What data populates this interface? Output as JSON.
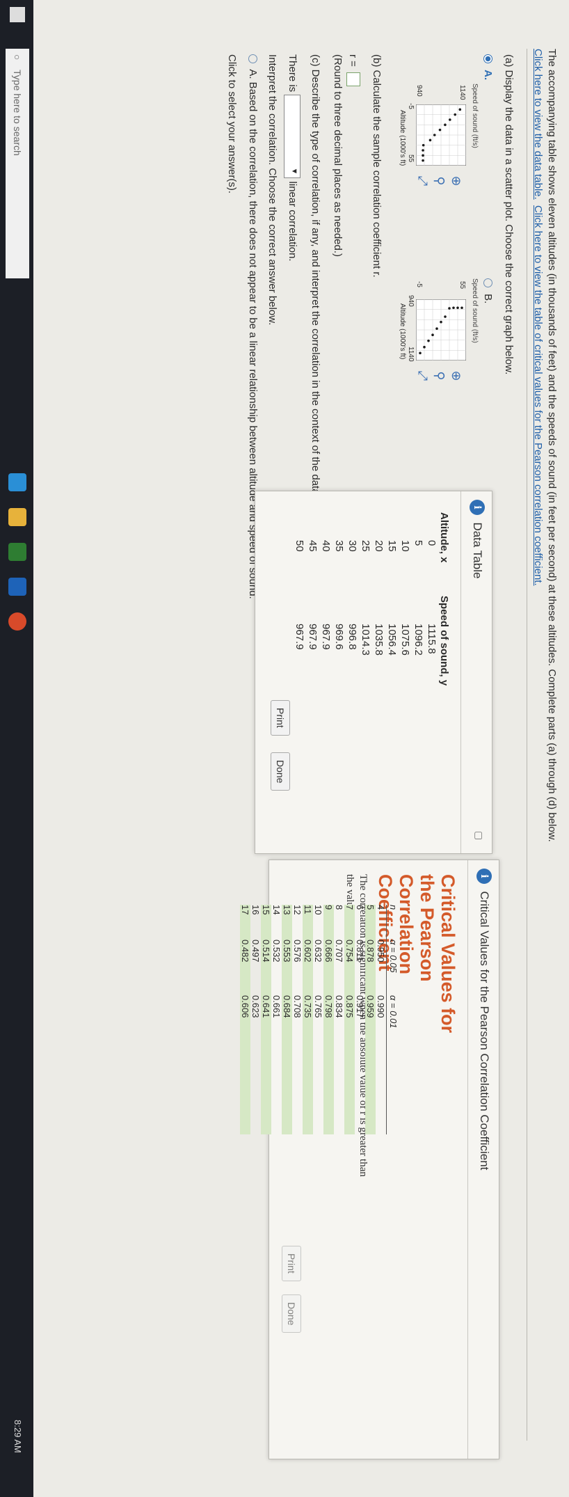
{
  "intro": {
    "text": "The accompanying table shows eleven altitudes (in thousands of feet) and the speeds of sound (in feet per second) at these altitudes. Complete parts (a) through (d) below.",
    "link1": "Click here to view the data table.",
    "link2": "Click here to view the table of critical values for the Pearson correlation coefficient."
  },
  "part_a": {
    "question": "(a) Display the data in a scatter plot. Choose the correct graph below.",
    "option_a": {
      "label": "A.",
      "ylabel": "Speed of sound (ft/s)",
      "xlabel": "Altitude (1000's ft)",
      "y_top": "1140",
      "y_bottom": "940",
      "x_left": "-5",
      "x_right": "55"
    },
    "option_b": {
      "label": "B.",
      "ylabel": "Speed of sound (ft/s)",
      "xlabel": "Altitude (1000's ft)",
      "y_top": "55",
      "y_bottom": "-5",
      "x_left": "940",
      "x_right": "1140"
    }
  },
  "part_b": {
    "question": "(b) Calculate the sample correlation coefficient r.",
    "r_label": "r =",
    "note": "(Round to three decimal places as needed.)"
  },
  "part_c": {
    "question": "(c) Describe the type of correlation, if any, and interpret the correlation in the context of the data.",
    "there_is": "There is",
    "linear": "linear correlation.",
    "interpret": "Interpret the correlation. Choose the correct answer below.",
    "option_a": "A.  Based on the correlation, there does not appear to be a linear relationship between altitude and speed of sound.",
    "click_select": "Click to select your answer(s)."
  },
  "data_table": {
    "title": "Data Table",
    "col_x": "Altitude, x",
    "col_y": "Speed of sound, y",
    "rows": [
      [
        "0",
        "1115.8"
      ],
      [
        "5",
        "1096.2"
      ],
      [
        "10",
        "1075.6"
      ],
      [
        "15",
        "1056.4"
      ],
      [
        "20",
        "1035.8"
      ],
      [
        "25",
        "1014.3"
      ],
      [
        "30",
        "996.8"
      ],
      [
        "35",
        "969.6"
      ],
      [
        "40",
        "967.9"
      ],
      [
        "45",
        "967.9"
      ],
      [
        "50",
        "967.9"
      ]
    ],
    "print": "Print",
    "done": "Done"
  },
  "crit_table": {
    "window_title": "Critical Values for the Pearson Correlation Coefficient",
    "heading": "Critical Values for the Pearson Correlation Coefficient",
    "desc": "The correlation is significant when the absolute value of r is greater than the value in the table.",
    "col_n": "n",
    "col_05": "α = 0.05",
    "col_01": "α = 0.01",
    "rows": [
      [
        "4",
        "0.950",
        "0.990"
      ],
      [
        "5",
        "0.878",
        "0.959"
      ],
      [
        "6",
        "0.811",
        "0.917"
      ],
      [
        "7",
        "0.754",
        "0.875"
      ],
      [
        "8",
        "0.707",
        "0.834"
      ],
      [
        "9",
        "0.666",
        "0.798"
      ],
      [
        "10",
        "0.632",
        "0.765"
      ],
      [
        "11",
        "0.602",
        "0.735"
      ],
      [
        "12",
        "0.576",
        "0.708"
      ],
      [
        "13",
        "0.553",
        "0.684"
      ],
      [
        "14",
        "0.532",
        "0.661"
      ],
      [
        "15",
        "0.514",
        "0.641"
      ],
      [
        "16",
        "0.497",
        "0.623"
      ],
      [
        "17",
        "0.482",
        "0.606"
      ]
    ],
    "print": "Print",
    "done": "Done"
  },
  "taskbar": {
    "search": "Type here to search",
    "time": "8:29 AM"
  },
  "scatter_points": {
    "x": [
      0,
      5,
      10,
      15,
      20,
      25,
      30,
      35,
      40,
      45,
      50
    ],
    "y": [
      1115.8,
      1096.2,
      1075.6,
      1056.4,
      1035.8,
      1014.3,
      996.8,
      969.6,
      967.9,
      967.9,
      967.9
    ]
  }
}
